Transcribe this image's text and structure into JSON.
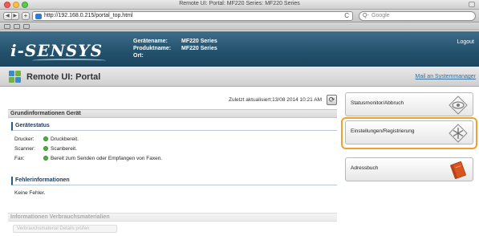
{
  "window": {
    "title": "Remote UI: Portal: MF220 Series: MF220 Series"
  },
  "browser": {
    "nav_back": "◀",
    "nav_forward": "▶",
    "new_tab": "+",
    "url": "http://192.168.0.215/portal_top.html",
    "reload": "C",
    "search_icon": "Q-",
    "search_placeholder": "Google"
  },
  "header": {
    "logo_text": "i-SENSYS",
    "device_name_label": "Gerätename:",
    "device_name_value": "MF220 Series",
    "product_name_label": "Produktname:",
    "product_name_value": "MF220 Series",
    "location_label": "Ort:",
    "location_value": "",
    "logout_label": "Logout"
  },
  "page": {
    "title": "Remote UI: Portal",
    "system_manager_link": "Mail an Systemmanager",
    "last_updated": "Zuletzt aktualisiert:13/08 2014 10:21 AM",
    "refresh_icon": "⟳"
  },
  "basic_info": {
    "section_title": "Grundinformationen Gerät",
    "device_status": {
      "title": "Gerätestatus",
      "rows": [
        {
          "label": "Drucker:",
          "status": "Druckbereit.",
          "color": "#4bb23e"
        },
        {
          "label": "Scanner:",
          "status": "Scanbereit.",
          "color": "#4bb23e"
        },
        {
          "label": "Fax:",
          "status": "Bereit zum Senden oder Empfangen von Faxen.",
          "color": "#4bb23e"
        }
      ]
    },
    "error_info": {
      "title": "Fehlerinformationen",
      "text": "Keine Fehler."
    }
  },
  "consumables": {
    "section_title": "Informationen Verbrauchsmaterialien",
    "details_button": "Verbrauchsmaterial Details prüfen"
  },
  "menu": {
    "status_monitor": {
      "label": "Statusmonitor/Abbruch",
      "icon": "eye-icon"
    },
    "settings": {
      "label": "Einstellungen/Registrierung",
      "icon": "gear-snowflake-icon",
      "highlighted": true,
      "highlight_color": "#f0a12c"
    },
    "address_book": {
      "label": "Adressbuch",
      "icon": "book-icon"
    }
  }
}
